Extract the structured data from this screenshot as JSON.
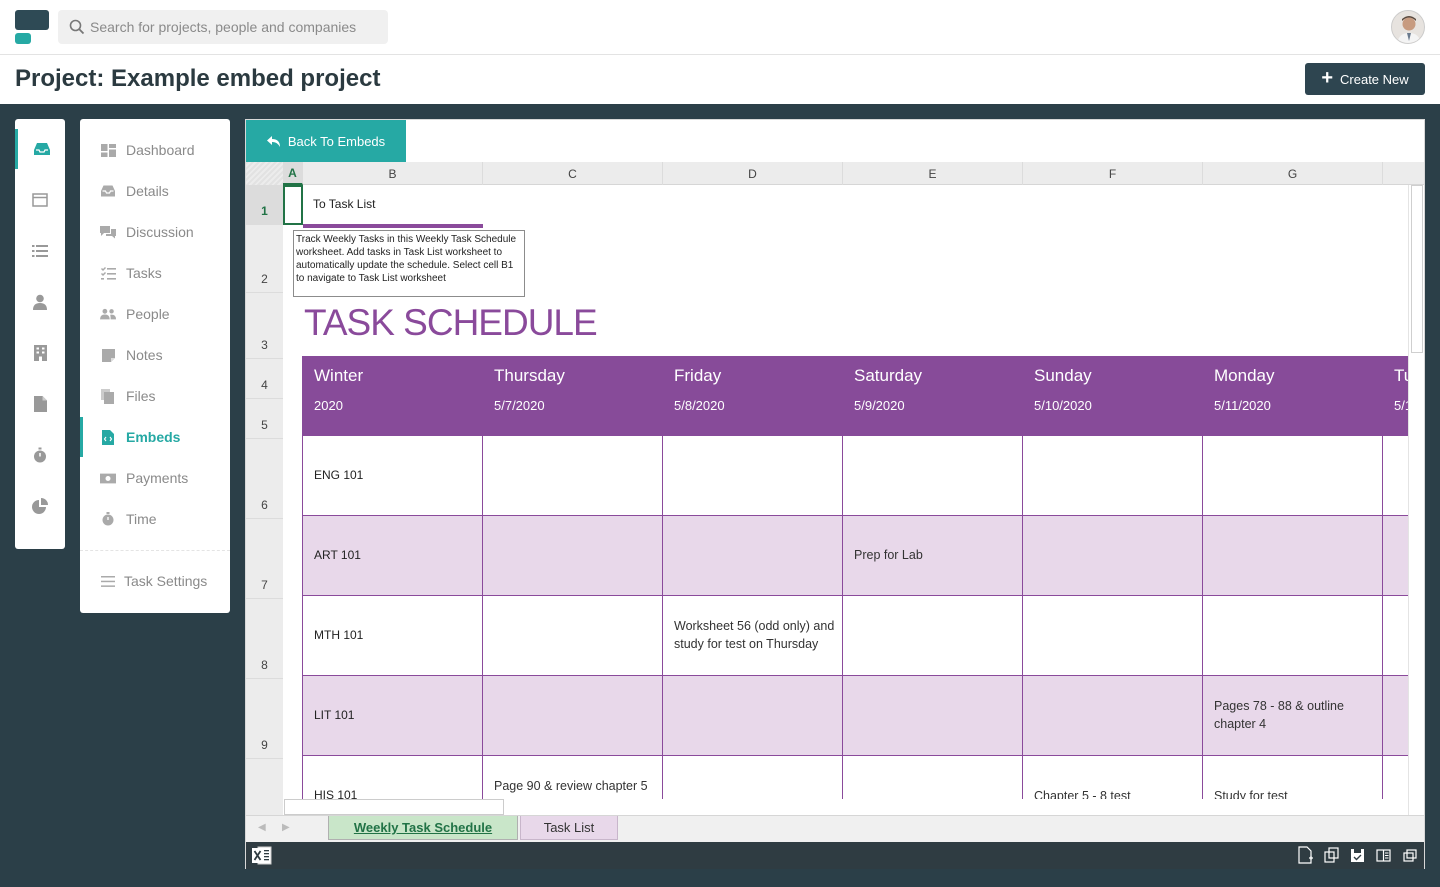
{
  "header": {
    "search_placeholder": "Search for projects, people and companies"
  },
  "titlebar": {
    "title": "Project: Example embed project",
    "create_label": "Create New"
  },
  "nav": {
    "items": [
      {
        "label": "Dashboard",
        "icon": "dashboard-icon"
      },
      {
        "label": "Details",
        "icon": "inbox-icon"
      },
      {
        "label": "Discussion",
        "icon": "chat-icon"
      },
      {
        "label": "Tasks",
        "icon": "tasks-icon"
      },
      {
        "label": "People",
        "icon": "people-icon"
      },
      {
        "label": "Notes",
        "icon": "note-icon"
      },
      {
        "label": "Files",
        "icon": "files-icon"
      },
      {
        "label": "Embeds",
        "icon": "embed-icon",
        "active": true
      },
      {
        "label": "Payments",
        "icon": "money-icon"
      },
      {
        "label": "Time",
        "icon": "stopwatch-icon"
      }
    ],
    "settings_label": "Task Settings"
  },
  "embed": {
    "back_label": "Back To Embeds"
  },
  "sheet": {
    "columns": [
      "A",
      "B",
      "C",
      "D",
      "E",
      "F",
      "G"
    ],
    "rows": [
      "1",
      "2",
      "3",
      "4",
      "5",
      "6",
      "7",
      "8",
      "9"
    ],
    "link_text": "To Task List",
    "note_text": "Track Weekly Tasks in this Weekly Task Schedule worksheet. Add tasks in Task List worksheet to automatically update the schedule. Select cell B1 to navigate to Task List worksheet",
    "title": "TASK SCHEDULE",
    "days": [
      {
        "name": "Winter",
        "date": "2020"
      },
      {
        "name": "Thursday",
        "date": "5/7/2020"
      },
      {
        "name": "Friday",
        "date": "5/8/2020"
      },
      {
        "name": "Saturday",
        "date": "5/9/2020"
      },
      {
        "name": "Sunday",
        "date": "5/10/2020"
      },
      {
        "name": "Monday",
        "date": "5/11/2020"
      },
      {
        "name": "Tu",
        "date": "5/1"
      }
    ],
    "courses": [
      "ENG 101",
      "ART 101",
      "MTH 101",
      "LIT 101",
      "HIS 101"
    ],
    "tasks": {
      "art_sat": "Prep for Lab",
      "mth_fri": "Worksheet 56 (odd only) and study for test on Thursday",
      "lit_mon": "Pages 78 - 88 & outline chapter 4",
      "his_thu": "Page 90 & review chapter 5",
      "his_sun": "Chapter 5 - 8 test",
      "his_mon": "Study for test"
    },
    "tabs": [
      "Weekly Task Schedule",
      "Task List"
    ]
  },
  "colors": {
    "accent": "#26a9a4",
    "dark": "#2b3f48",
    "purple": "#874b99",
    "purple_light": "#e8d8ea",
    "excel_green": "#217346"
  }
}
